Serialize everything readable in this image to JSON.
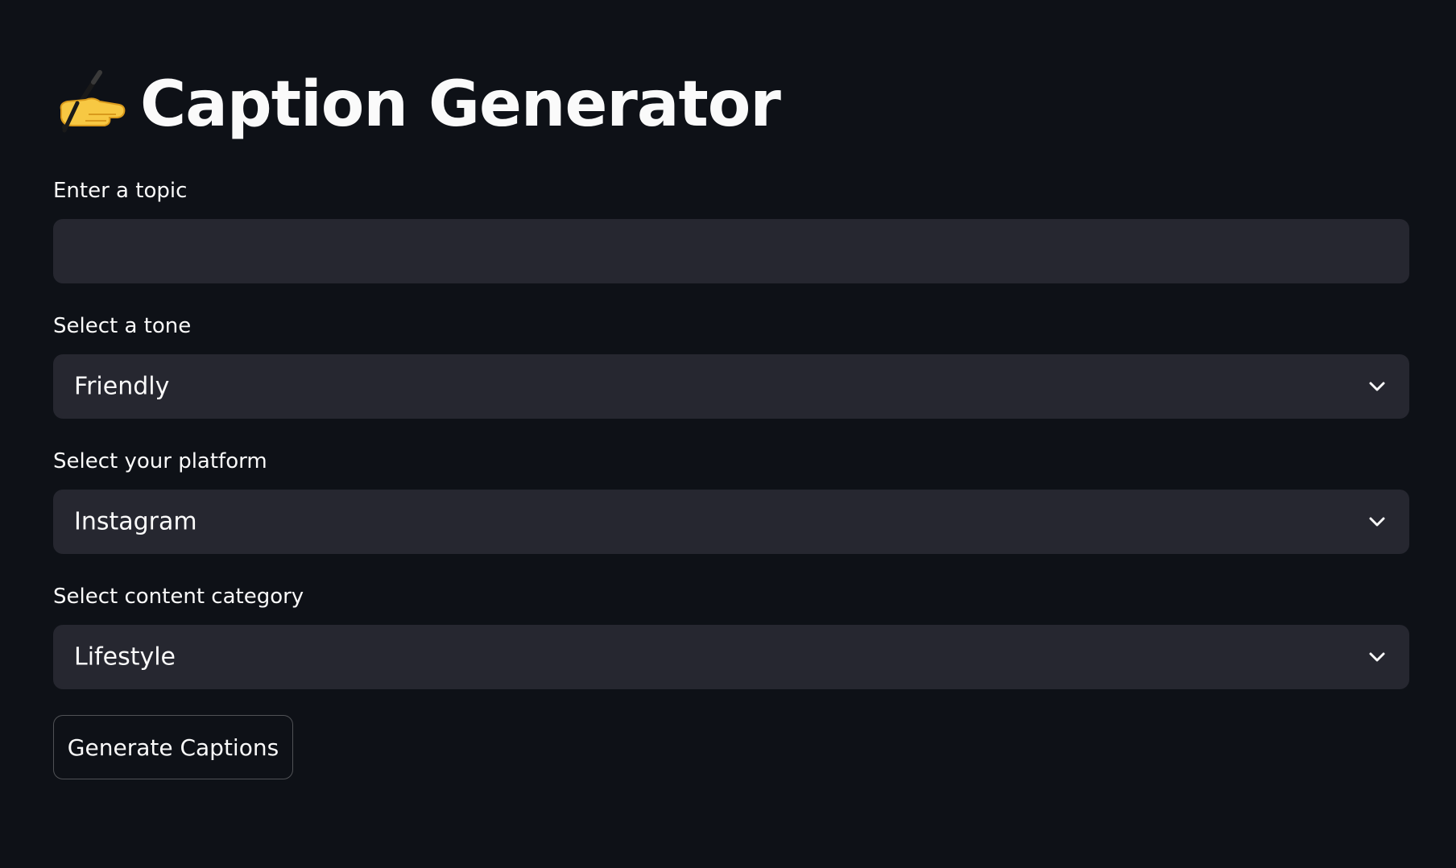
{
  "title": {
    "emoji": "✍️",
    "text": "Caption Generator"
  },
  "topic": {
    "label": "Enter a topic",
    "value": "",
    "placeholder": ""
  },
  "tone": {
    "label": "Select a tone",
    "selected": "Friendly"
  },
  "platform": {
    "label": "Select your platform",
    "selected": "Instagram"
  },
  "category": {
    "label": "Select content category",
    "selected": "Lifestyle"
  },
  "actions": {
    "generate_label": "Generate Captions"
  },
  "colors": {
    "background": "#0e1117",
    "input_bg": "#262730",
    "text": "#fafafa"
  },
  "icons": {
    "title_icon": "writing-hand-icon",
    "select_icon": "chevron-down-icon"
  }
}
